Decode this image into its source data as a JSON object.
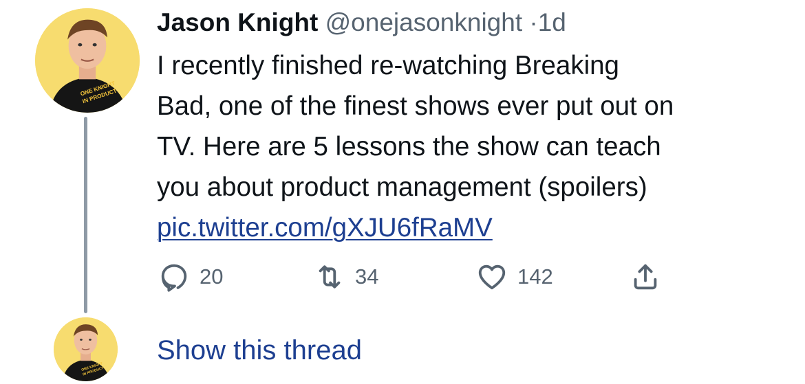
{
  "tweet": {
    "author_name": "Jason Knight",
    "handle": "@onejasonknight",
    "separator": "·",
    "timestamp": "1d",
    "text_line_1": "I recently finished re-watching Breaking",
    "text_line_2": "Bad, one of the finest shows ever put out on",
    "text_line_3": "TV. Here are 5 lessons the show can teach",
    "text_line_4": "you about product management (spoilers)",
    "link": "pic.twitter.com/gXJU6fRaMV",
    "avatar_shirt_text_1": "ONE KNIGHT",
    "avatar_shirt_text_2": "IN PRODUCT"
  },
  "actions": {
    "reply_count": "20",
    "retweet_count": "34",
    "like_count": "142"
  },
  "thread": {
    "show_label": "Show this thread"
  },
  "icons": {
    "reply": "reply-icon",
    "retweet": "retweet-icon",
    "like": "heart-icon",
    "share": "share-icon"
  },
  "colors": {
    "text": "#0f1419",
    "secondary": "#566370",
    "link": "#1d3f91",
    "avatar_bg": "#f7dc6f",
    "thread_line": "#8e9aa6"
  }
}
